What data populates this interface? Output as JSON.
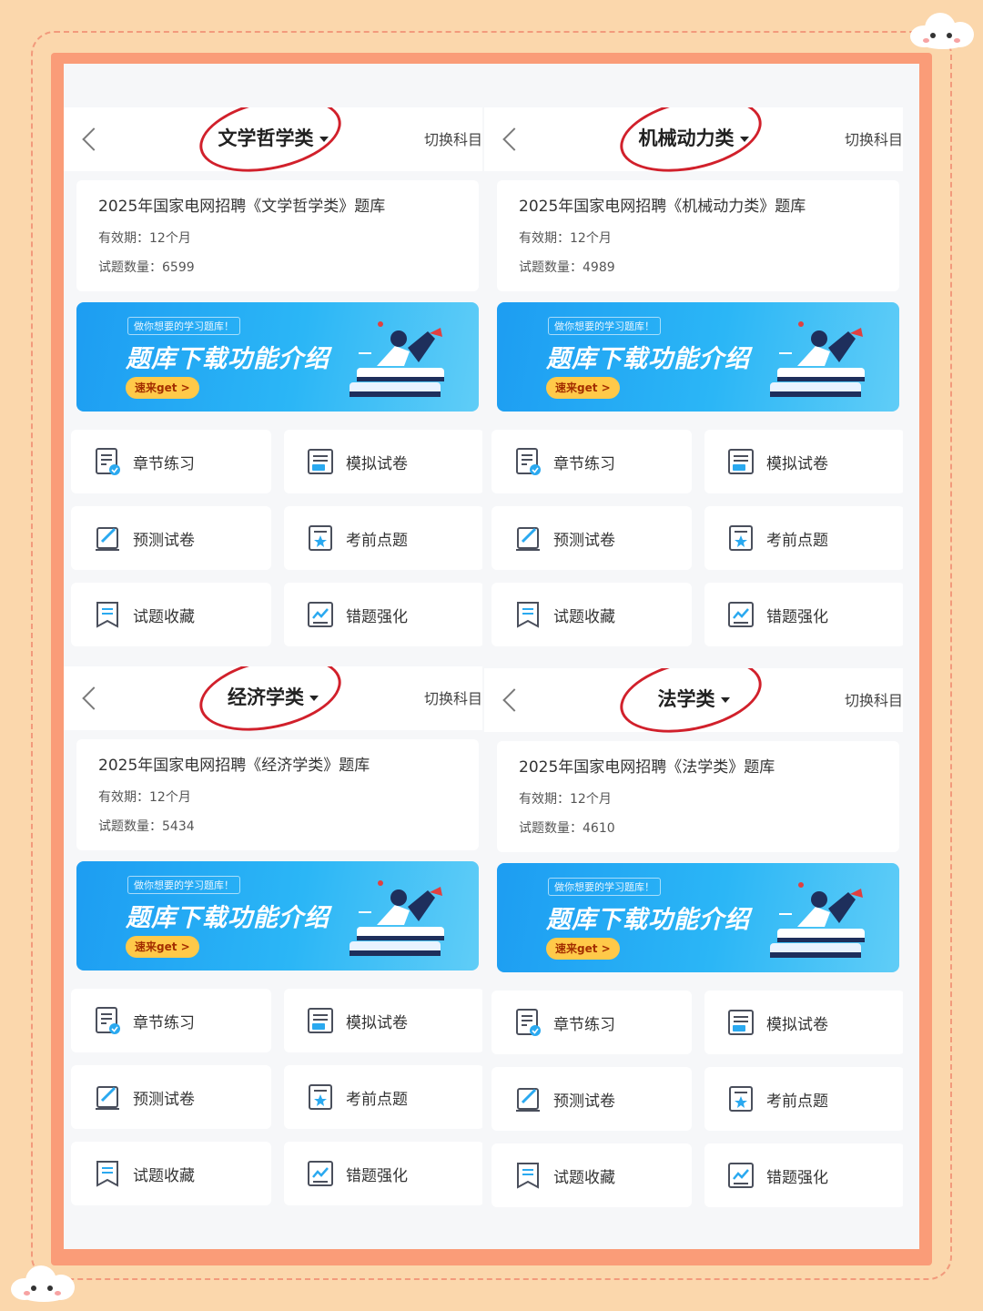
{
  "colors": {
    "accent": "#1d9df2",
    "frame": "#fa9c78",
    "background": "#fbd7ac",
    "circle": "#d1202b",
    "icon": "#4a4f5c"
  },
  "panels": [
    {
      "title": "文学哲学类",
      "back_icon": "chevron-left-icon",
      "switch_label": "切换科目",
      "info": {
        "title": "2025年国家电网招聘《文学哲学类》题库",
        "validity": "有效期：12个月",
        "count": "试题数量：6599"
      },
      "banner": {
        "tag": "做你想要的学习题库！",
        "title": "题库下载功能介绍",
        "button": "速来get >"
      },
      "menu": [
        {
          "label": "章节练习",
          "icon": "chapter-practice-icon"
        },
        {
          "label": "模拟试卷",
          "icon": "mock-exam-icon"
        },
        {
          "label": "预测试卷",
          "icon": "predict-exam-icon"
        },
        {
          "label": "考前点题",
          "icon": "pre-exam-tips-icon"
        },
        {
          "label": "试题收藏",
          "icon": "favorites-icon"
        },
        {
          "label": "错题强化",
          "icon": "wrong-questions-icon"
        }
      ]
    },
    {
      "title": "机械动力类",
      "back_icon": "chevron-left-icon",
      "switch_label": "切换科目",
      "info": {
        "title": "2025年国家电网招聘《机械动力类》题库",
        "validity": "有效期：12个月",
        "count": "试题数量：4989"
      },
      "banner": {
        "tag": "做你想要的学习题库！",
        "title": "题库下载功能介绍",
        "button": "速来get >"
      },
      "menu": [
        {
          "label": "章节练习",
          "icon": "chapter-practice-icon"
        },
        {
          "label": "模拟试卷",
          "icon": "mock-exam-icon"
        },
        {
          "label": "预测试卷",
          "icon": "predict-exam-icon"
        },
        {
          "label": "考前点题",
          "icon": "pre-exam-tips-icon"
        },
        {
          "label": "试题收藏",
          "icon": "favorites-icon"
        },
        {
          "label": "错题强化",
          "icon": "wrong-questions-icon"
        }
      ]
    },
    {
      "title": "经济学类",
      "back_icon": "chevron-left-icon",
      "switch_label": "切换科目",
      "info": {
        "title": "2025年国家电网招聘《经济学类》题库",
        "validity": "有效期：12个月",
        "count": "试题数量：5434"
      },
      "banner": {
        "tag": "做你想要的学习题库！",
        "title": "题库下载功能介绍",
        "button": "速来get >"
      },
      "menu": [
        {
          "label": "章节练习",
          "icon": "chapter-practice-icon"
        },
        {
          "label": "模拟试卷",
          "icon": "mock-exam-icon"
        },
        {
          "label": "预测试卷",
          "icon": "predict-exam-icon"
        },
        {
          "label": "考前点题",
          "icon": "pre-exam-tips-icon"
        },
        {
          "label": "试题收藏",
          "icon": "favorites-icon"
        },
        {
          "label": "错题强化",
          "icon": "wrong-questions-icon"
        }
      ]
    },
    {
      "title": "法学类",
      "back_icon": "chevron-left-icon",
      "switch_label": "切换科目",
      "info": {
        "title": "2025年国家电网招聘《法学类》题库",
        "validity": "有效期：12个月",
        "count": "试题数量：4610"
      },
      "banner": {
        "tag": "做你想要的学习题库！",
        "title": "题库下载功能介绍",
        "button": "速来get >"
      },
      "menu": [
        {
          "label": "章节练习",
          "icon": "chapter-practice-icon"
        },
        {
          "label": "模拟试卷",
          "icon": "mock-exam-icon"
        },
        {
          "label": "预测试卷",
          "icon": "predict-exam-icon"
        },
        {
          "label": "考前点题",
          "icon": "pre-exam-tips-icon"
        },
        {
          "label": "试题收藏",
          "icon": "favorites-icon"
        },
        {
          "label": "错题强化",
          "icon": "wrong-questions-icon"
        }
      ]
    }
  ]
}
